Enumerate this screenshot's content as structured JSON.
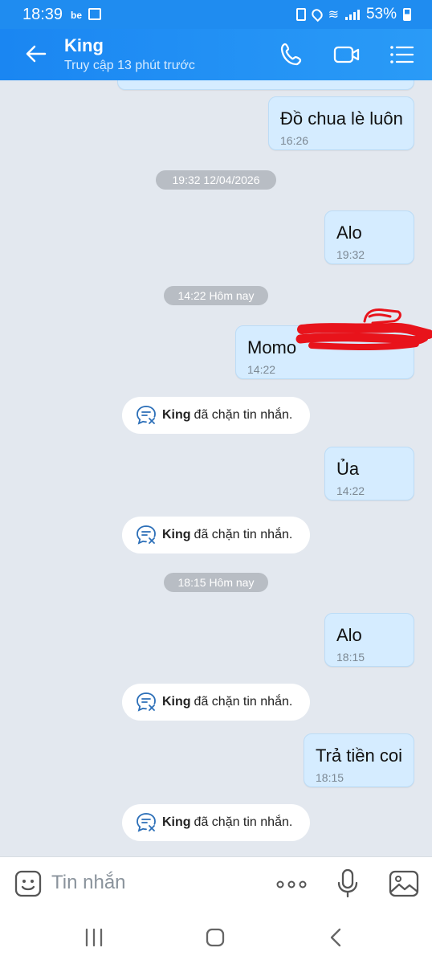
{
  "status_bar": {
    "time": "18:39",
    "app_badge": "be",
    "battery_percent": "53%"
  },
  "header": {
    "contact_name": "King",
    "last_seen": "Truy cập 13 phút trước"
  },
  "messages": [
    {
      "text": "Đồ chua lè luôn",
      "time": "16:26"
    },
    {
      "text": "Alo",
      "time": "19:32"
    },
    {
      "text": "Momo",
      "time": "14:22"
    },
    {
      "text": "Ủa",
      "time": "14:22"
    },
    {
      "text": "Alo",
      "time": "18:15"
    },
    {
      "text": "Trả tiền coi",
      "time": "18:15"
    }
  ],
  "date_separators": [
    "19:32 12/04/2026",
    "14:22 Hôm nay",
    "18:15 Hôm nay"
  ],
  "system_notice": {
    "name": "King",
    "text": "đã chặn tin nhắn."
  },
  "composer": {
    "placeholder": "Tin nhắn"
  },
  "colors": {
    "header": "#1f8cf0",
    "bubble": "#d5ecff",
    "background": "#e3e8ef",
    "redaction": "#e8131b"
  }
}
